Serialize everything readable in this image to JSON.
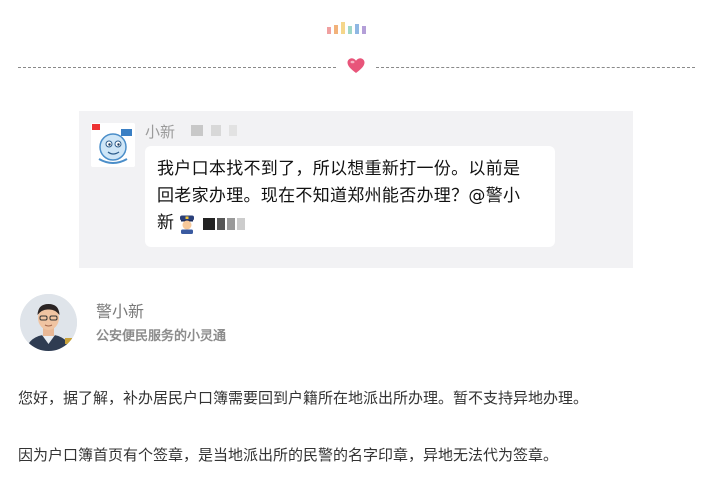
{
  "decor": {
    "bar_colors": [
      "#f0a0a0",
      "#f2b27a",
      "#f5d68a",
      "#9fd7c6",
      "#8fb7e3",
      "#b49fd8"
    ],
    "accent": "#e8557a"
  },
  "chat": {
    "sender_name": "小新",
    "message_line1": "我户口本找不到了，所以想重新打一份。以前是",
    "message_line2": "回老家办理。现在不知道郑州能否办理？@警小",
    "message_line3": "新"
  },
  "profile": {
    "name": "警小新",
    "description": "公安便民服务的小灵通"
  },
  "answer": {
    "paragraph1": "您好，据了解，补办居民户口簿需要回到户籍所在地派出所办理。暂不支持异地办理。",
    "paragraph2": "因为户口簿首页有个签章，是当地派出所的民警的名字印章，异地无法代为签章。"
  }
}
